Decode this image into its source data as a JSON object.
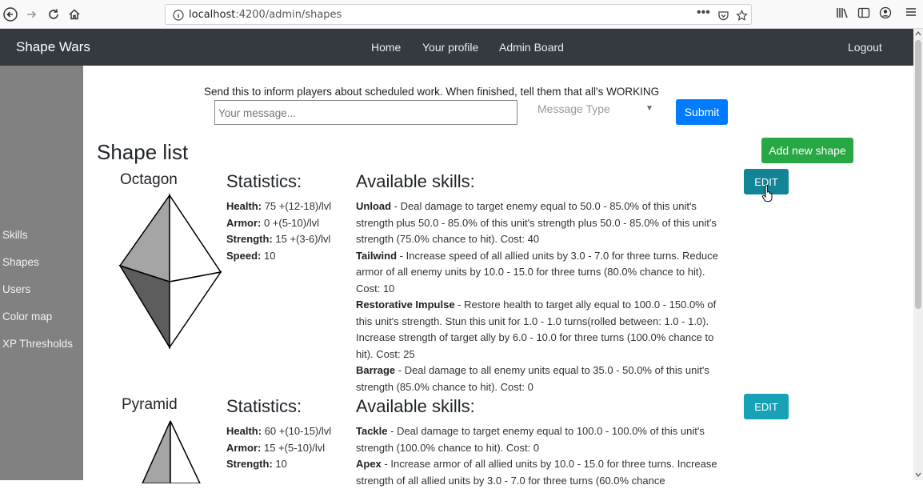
{
  "browser": {
    "url_prefix": "localhost",
    "url_rest": ":4200/admin/shapes"
  },
  "navbar": {
    "brand": "Shape Wars",
    "links": [
      "Home",
      "Your profile",
      "Admin Board"
    ],
    "logout": "Logout"
  },
  "sidebar": {
    "items": [
      "Skills",
      "Shapes",
      "Users",
      "Color map",
      "XP Thresholds"
    ]
  },
  "announcement": {
    "text": "Send this to inform players about scheduled work. When finished, tell them that all's WORKING",
    "placeholder": "Your message...",
    "type_placeholder": "Message Type",
    "submit": "Submit"
  },
  "page": {
    "title": "Shape list",
    "add_button": "Add new shape"
  },
  "labels": {
    "statistics": "Statistics:",
    "skills": "Available skills:",
    "edit": "EDIT"
  },
  "colors": {
    "navbar": "#343a40",
    "sidebar": "#818181",
    "primary": "#007bff",
    "success": "#28a745",
    "edit": "#17a2b8",
    "edit_hover": "#138496"
  },
  "shapes": [
    {
      "name": "Octagon",
      "stats": [
        {
          "label": "Health:",
          "value": "75 +(12-18)/lvl"
        },
        {
          "label": "Armor:",
          "value": "0 +(5-10)/lvl"
        },
        {
          "label": "Strength:",
          "value": "15 +(3-6)/lvl"
        },
        {
          "label": "Speed:",
          "value": "10"
        }
      ],
      "skills": [
        {
          "name": "Unload",
          "desc": " - Deal damage to target enemy equal to 50.0 - 85.0% of this unit's strength plus 50.0 - 85.0% of this unit's strength plus 50.0 - 85.0% of this unit's strength (75.0% chance to hit). Cost: 40"
        },
        {
          "name": "Tailwind",
          "desc": " - Increase speed of all allied units by 3.0 - 7.0 for three turns. Reduce armor of all enemy units by 10.0 - 15.0 for three turns (80.0% chance to hit). Cost: 10"
        },
        {
          "name": "Restorative Impulse",
          "desc": " - Restore health to target ally equal to 100.0 - 150.0% of this unit's strength. Stun this unit for 1.0 - 1.0 turns(rolled between: 1.0 - 1.0). Increase strength of target ally by 6.0 - 10.0 for three turns (100.0% chance to hit). Cost: 25"
        },
        {
          "name": "Barrage",
          "desc": " - Deal damage to all enemy units equal to 35.0 - 50.0% of this unit's strength (85.0% chance to hit). Cost: 0"
        }
      ]
    },
    {
      "name": "Pyramid",
      "stats": [
        {
          "label": "Health:",
          "value": "60 +(10-15)/lvl"
        },
        {
          "label": "Armor:",
          "value": "15 +(5-10)/lvl"
        },
        {
          "label": "Strength:",
          "value": "10"
        }
      ],
      "skills": [
        {
          "name": "Tackle",
          "desc": " - Deal damage to target enemy equal to 100.0 - 100.0% of this unit's strength (100.0% chance to hit). Cost: 0"
        },
        {
          "name": "Apex",
          "desc": " - Increase armor of all allied units by 10.0 - 15.0 for three turns. Increase strength of all allied units by 3.0 - 7.0 for three turns (60.0% chance"
        }
      ]
    }
  ]
}
